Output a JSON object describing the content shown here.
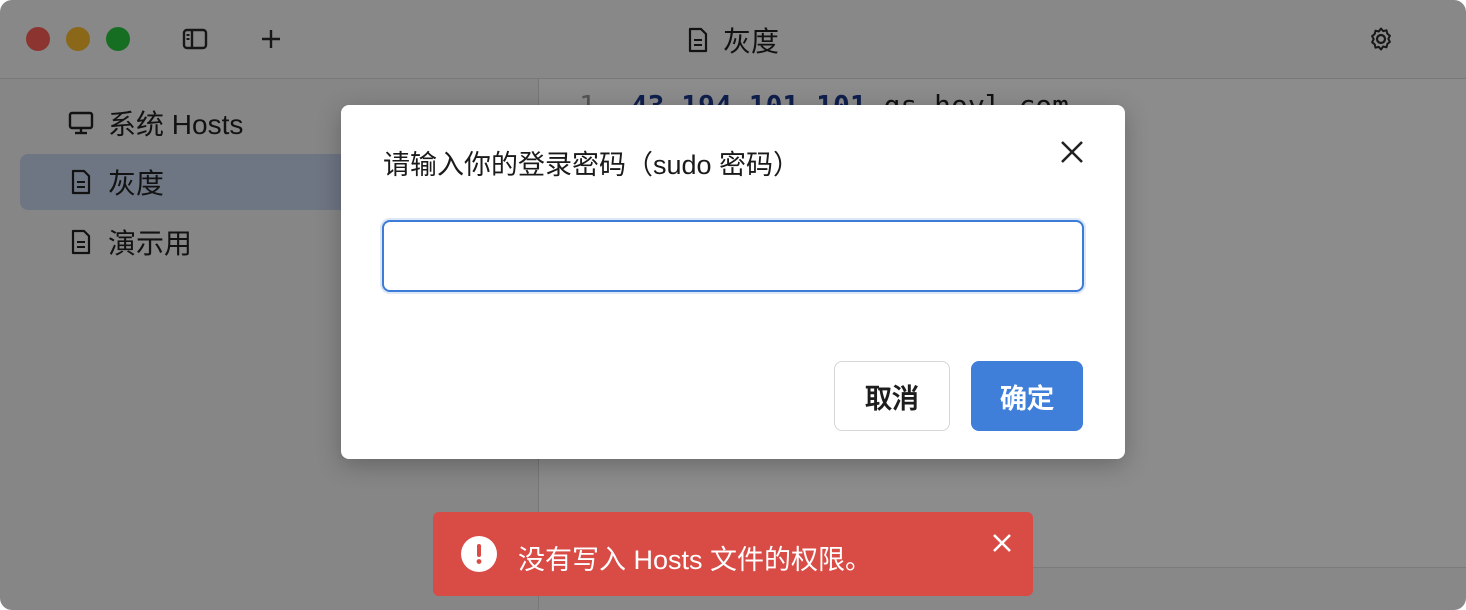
{
  "window": {
    "title": "灰度"
  },
  "sidebar": {
    "items": [
      {
        "label": "系统 Hosts",
        "icon": "monitor-icon"
      },
      {
        "label": "灰度",
        "icon": "document-icon",
        "selected": true
      },
      {
        "label": "演示用",
        "icon": "document-icon"
      }
    ]
  },
  "editor": {
    "line_number": "1",
    "ip": "43.194.101.101",
    "host": "gs.hoyl.com"
  },
  "dialog": {
    "title": "请输入你的登录密码（sudo 密码）",
    "password_value": "",
    "cancel_label": "取消",
    "ok_label": "确定"
  },
  "toast": {
    "message": "没有写入 Hosts 文件的权限。"
  },
  "colors": {
    "accent": "#3f7ed9",
    "error": "#d94b45",
    "selected_bg": "#c9d6ee"
  }
}
